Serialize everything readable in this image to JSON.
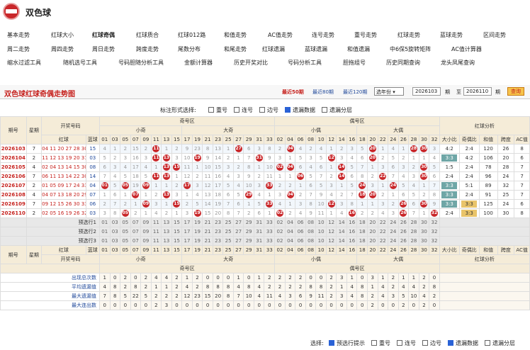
{
  "app": {
    "title": "双色球"
  },
  "nav": [
    [
      "基本走势",
      "红球大小",
      "红球奇偶",
      "红球质合",
      "红球012路",
      "和值走势",
      "AC值走势",
      "连号走势",
      "重号走势",
      "红球走势",
      "蓝球走势",
      "区间走势"
    ],
    [
      "周二走势",
      "周四走势",
      "周日走势",
      "跨度走势",
      "尾数分布",
      "和尾走势",
      "红球遗漏",
      "蓝球遗漏",
      "和值遗漏",
      "中6保5旋转矩阵",
      "AC值计算器"
    ],
    [
      "缩水过滤工具",
      "随机选号工具",
      "号码胆随分析工具",
      "金额计算器",
      "历史开奖对比",
      "号码分析工具",
      "胆拖组号",
      "历史同期查询",
      "龙头凤尾查询"
    ]
  ],
  "nav_active": "红球奇偶",
  "chart": {
    "title": "双色球红球奇偶走势图",
    "ranges": [
      "最近50期",
      "最近80期",
      "最近120期"
    ],
    "range_active": "最近50期",
    "select": "选年份",
    "from": "2026103",
    "to": "2026110",
    "period_unit": "期",
    "to_label": "至",
    "query": "查询"
  },
  "options": {
    "label": "标注形式选择:",
    "items": [
      {
        "t": "重号",
        "on": false
      },
      {
        "t": "连号",
        "on": false
      },
      {
        "t": "边号",
        "on": false
      },
      {
        "t": "遗漏数据",
        "on": true
      },
      {
        "t": "遗漏分层",
        "on": false
      }
    ]
  },
  "headers": {
    "issue": "期号",
    "week": "星期",
    "draw": "开奖号码",
    "red": "红球",
    "blue": "蓝球",
    "odd_zone": "奇号区",
    "even_zone": "偶号区",
    "small_odd": "小奇",
    "big_odd": "大奇",
    "small_even": "小偶",
    "big_even": "大偶",
    "analysis": "红球分析",
    "size_ratio": "大小比",
    "parity_ratio": "奇偶比",
    "sum": "和值",
    "span": "跨度",
    "ac": "AC值"
  },
  "odd_nums": [
    "01",
    "03",
    "05",
    "07",
    "09",
    "11",
    "13",
    "15",
    "17",
    "19",
    "21",
    "23",
    "25",
    "27",
    "29",
    "31",
    "33"
  ],
  "even_nums": [
    "02",
    "04",
    "06",
    "08",
    "10",
    "12",
    "14",
    "16",
    "18",
    "20",
    "22",
    "24",
    "26",
    "28",
    "30",
    "32"
  ],
  "rows": [
    {
      "issue": "2026103",
      "week": "7",
      "red": "04 11 20 27 28 30",
      "blue": "15",
      "odd": [
        "4",
        "1",
        "2",
        "15",
        "2",
        "@11",
        "1",
        "2",
        "9",
        "23",
        "8",
        "13",
        "1",
        "@27",
        "6",
        "3",
        "8"
      ],
      "even": [
        "2",
        "@04",
        "4",
        "2",
        "4",
        "1",
        "2",
        "3",
        "5",
        "@20",
        "1",
        "4",
        "1",
        "@28",
        "@30",
        "3"
      ],
      "size": "4:2",
      "par": "2:4",
      "sum": "120",
      "span": "26",
      "ac": "8"
    },
    {
      "issue": "2026104",
      "week": "2",
      "red": "11 12 13 19 20 31",
      "blue": "03",
      "odd": [
        "5",
        "2",
        "3",
        "16",
        "3",
        "@11",
        "@13",
        "3",
        "10",
        "@19",
        "9",
        "14",
        "2",
        "1",
        "7",
        "@31",
        "9"
      ],
      "even": [
        "3",
        "1",
        "5",
        "3",
        "5",
        "@12",
        "3",
        "4",
        "6",
        "@20",
        "2",
        "5",
        "2",
        "1",
        "1",
        "4"
      ],
      "size": "3:3",
      "par": "4:2",
      "sum": "106",
      "span": "20",
      "ac": "6"
    },
    {
      "issue": "2026105",
      "week": "4",
      "red": "02 04 13 14 15 30",
      "blue": "08",
      "odd": [
        "6",
        "3",
        "4",
        "17",
        "4",
        "1",
        "@13",
        "@15",
        "11",
        "1",
        "10",
        "15",
        "3",
        "2",
        "8",
        "1",
        "10"
      ],
      "even": [
        "@02",
        "@04",
        "6",
        "4",
        "6",
        "1",
        "@14",
        "5",
        "7",
        "1",
        "3",
        "6",
        "3",
        "2",
        "@30",
        "5"
      ],
      "size": "1:5",
      "par": "2:4",
      "sum": "78",
      "span": "28",
      "ac": "7"
    },
    {
      "issue": "2026106",
      "week": "7",
      "red": "06 11 13 14 22 30",
      "blue": "14",
      "odd": [
        "7",
        "4",
        "5",
        "18",
        "5",
        "@11",
        "@13",
        "1",
        "12",
        "2",
        "11",
        "16",
        "4",
        "3",
        "9",
        "2",
        "11"
      ],
      "even": [
        "1",
        "1",
        "@06",
        "5",
        "7",
        "2",
        "@14",
        "6",
        "8",
        "2",
        "@22",
        "7",
        "4",
        "3",
        "@30",
        "6"
      ],
      "size": "2:4",
      "par": "2:4",
      "sum": "96",
      "span": "24",
      "ac": "7"
    },
    {
      "issue": "2026107",
      "week": "2",
      "red": "01 05 09 17 24 33",
      "blue": "04",
      "odd": [
        "@01",
        "5",
        "@05",
        "19",
        "@09",
        "1",
        "1",
        "2",
        "@17",
        "3",
        "12",
        "17",
        "5",
        "4",
        "10",
        "3",
        "@33"
      ],
      "even": [
        "2",
        "2",
        "1",
        "6",
        "5",
        "3",
        "1",
        "5",
        "@24",
        "3",
        "1",
        "@24",
        "5",
        "4",
        "1",
        "7"
      ],
      "size": "3:3",
      "par": "5:1",
      "sum": "89",
      "span": "32",
      "ac": "7"
    },
    {
      "issue": "2026108",
      "week": "4",
      "red": "04 07 13 18 20 29",
      "blue": "07",
      "odd": [
        "1",
        "6",
        "1",
        "@07",
        "1",
        "2",
        "@13",
        "3",
        "1",
        "4",
        "13",
        "18",
        "6",
        "5",
        "@29",
        "4",
        "1"
      ],
      "even": [
        "3",
        "@04",
        "2",
        "7",
        "9",
        "4",
        "2",
        "7",
        "@18",
        "@20",
        "2",
        "1",
        "6",
        "5",
        "2",
        "8"
      ],
      "size": "3:3",
      "par": "2:4",
      "sum": "91",
      "span": "25",
      "ac": "7"
    },
    {
      "issue": "2026109",
      "week": "7",
      "red": "09 12 15 26 30 33",
      "blue": "06",
      "odd": [
        "2",
        "7",
        "2",
        "1",
        "@09",
        "3",
        "1",
        "@15",
        "2",
        "5",
        "14",
        "19",
        "7",
        "6",
        "1",
        "5",
        "@33"
      ],
      "even": [
        "4",
        "1",
        "3",
        "8",
        "10",
        "@12",
        "3",
        "8",
        "1",
        "1",
        "3",
        "2",
        "@26",
        "6",
        "@30",
        "9"
      ],
      "size": "3:3",
      "par": "3:3",
      "sum": "125",
      "span": "24",
      "ac": "6"
    },
    {
      "issue": "2026110",
      "week": "2",
      "red": "02 05 16 19 26 32",
      "blue": "03",
      "odd": [
        "3",
        "8",
        "@05",
        "2",
        "1",
        "4",
        "2",
        "1",
        "3",
        "@19",
        "15",
        "20",
        "8",
        "7",
        "2",
        "6",
        "1"
      ],
      "even": [
        "@02",
        "2",
        "4",
        "9",
        "11",
        "1",
        "4",
        "@16",
        "2",
        "2",
        "4",
        "3",
        "@26",
        "7",
        "1",
        "@32"
      ],
      "size": "2:4",
      "par": "3:3",
      "sum": "100",
      "span": "30",
      "ac": "8"
    }
  ],
  "preselect": [
    "预选行1",
    "预选行2",
    "预选行3"
  ],
  "stats": [
    {
      "label": "出现总次数",
      "odd": [
        "1",
        "0",
        "2",
        "0",
        "2",
        "4",
        "4",
        "2",
        "1",
        "2",
        "0",
        "0",
        "0",
        "1",
        "0",
        "1",
        "2"
      ],
      "even": [
        "2",
        "2",
        "2",
        "0",
        "0",
        "2",
        "3",
        "1",
        "0",
        "3",
        "1",
        "2",
        "1",
        "1",
        "2",
        "0"
      ]
    },
    {
      "label": "平均遗漏值",
      "odd": [
        "4",
        "8",
        "2",
        "8",
        "2",
        "1",
        "1",
        "2",
        "4",
        "2",
        "8",
        "8",
        "8",
        "4",
        "8",
        "4",
        "2"
      ],
      "even": [
        "2",
        "2",
        "2",
        "8",
        "8",
        "2",
        "1",
        "4",
        "8",
        "1",
        "4",
        "2",
        "4",
        "4",
        "2",
        "8"
      ]
    },
    {
      "label": "最大遗漏值",
      "odd": [
        "7",
        "8",
        "5",
        "22",
        "5",
        "2",
        "2",
        "2",
        "12",
        "23",
        "15",
        "20",
        "8",
        "7",
        "10",
        "4",
        "11"
      ],
      "even": [
        "4",
        "3",
        "6",
        "9",
        "11",
        "2",
        "3",
        "4",
        "8",
        "2",
        "4",
        "3",
        "5",
        "10",
        "4",
        "2"
      ]
    },
    {
      "label": "最大连出数",
      "odd": [
        "0",
        "0",
        "0",
        "0",
        "0",
        "2",
        "3",
        "0",
        "0",
        "0",
        "0",
        "0",
        "0",
        "0",
        "0",
        "0",
        "0"
      ],
      "even": [
        "0",
        "0",
        "0",
        "0",
        "0",
        "0",
        "0",
        "0",
        "0",
        "2",
        "0",
        "0",
        "2",
        "0",
        "2",
        "0"
      ]
    }
  ],
  "footer": {
    "label": "选择:",
    "items": [
      {
        "t": "预选行提示",
        "on": true
      },
      {
        "t": "重号",
        "on": false
      },
      {
        "t": "连号",
        "on": false
      },
      {
        "t": "边号",
        "on": false
      },
      {
        "t": "遗漏数据",
        "on": true
      },
      {
        "t": "遗漏分层",
        "on": false
      }
    ]
  }
}
